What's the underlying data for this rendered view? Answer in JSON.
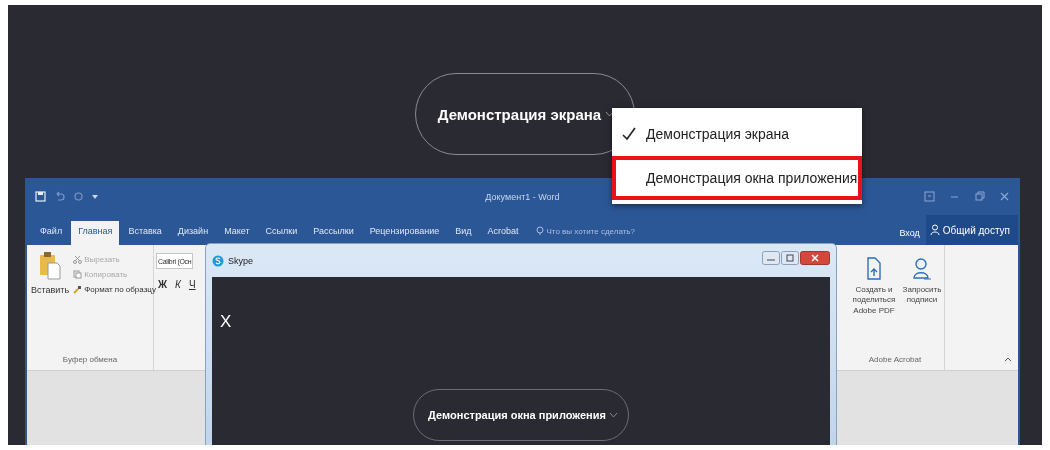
{
  "share_button": {
    "label": "Демонстрация экрана"
  },
  "share_menu": {
    "items": [
      {
        "label": "Демонстрация экрана",
        "checked": true,
        "highlighted": false
      },
      {
        "label": "Демонстрация окна приложения",
        "checked": false,
        "highlighted": true
      }
    ]
  },
  "word_window": {
    "title": "Документ1 - Word",
    "tabs": [
      {
        "label": "Файл",
        "selected": false
      },
      {
        "label": "Главная",
        "selected": true
      },
      {
        "label": "Вставка",
        "selected": false
      },
      {
        "label": "Дизайн",
        "selected": false
      },
      {
        "label": "Макет",
        "selected": false
      },
      {
        "label": "Ссылки",
        "selected": false
      },
      {
        "label": "Рассылки",
        "selected": false
      },
      {
        "label": "Рецензирование",
        "selected": false
      },
      {
        "label": "Вид",
        "selected": false
      },
      {
        "label": "Acrobat",
        "selected": false
      }
    ],
    "search": {
      "placeholder": "Что вы хотите сделать?"
    },
    "sign_in": "Вход",
    "share": "Общий доступ",
    "clipboard": {
      "paste": "Вставить",
      "items": [
        {
          "label": "Вырезать",
          "disabled": true
        },
        {
          "label": "Копировать",
          "disabled": true
        },
        {
          "label": "Формат по образцу",
          "disabled": false
        }
      ],
      "group_label": "Буфер обмена"
    },
    "font": {
      "name": "Calibri (Осн",
      "bold": "Ж",
      "italic": "К",
      "underline": "Ч"
    },
    "acrobat": {
      "create": "Создать и поделиться Adobe PDF",
      "request": "Запросить подписи",
      "group_label": "Adobe Acrobat"
    }
  },
  "skype_window": {
    "title": "Skype",
    "close": "X",
    "share_button": {
      "label": "Демонстрация окна приложения"
    }
  }
}
